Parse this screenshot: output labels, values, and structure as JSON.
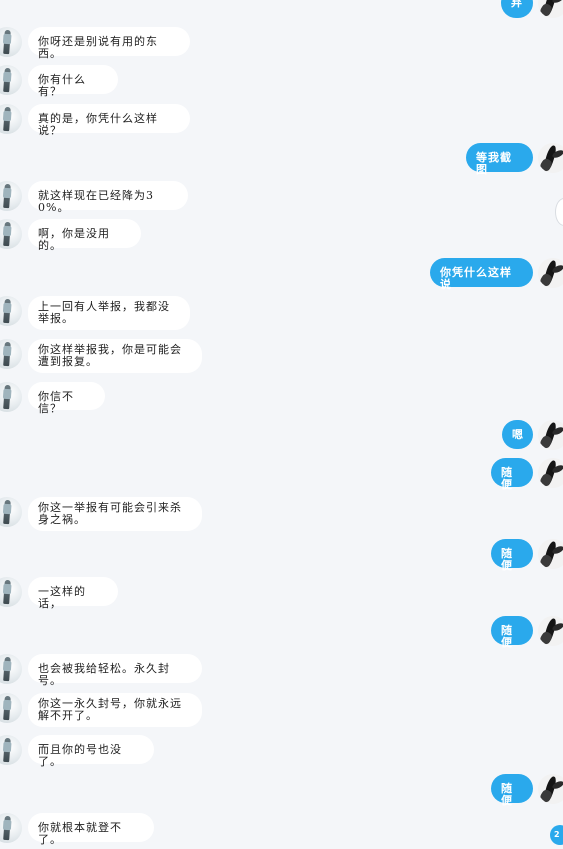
{
  "chat": {
    "messages": [
      {
        "side": "out",
        "text": "弃"
      },
      {
        "side": "in",
        "text": "你呀还是别说有用的东西。"
      },
      {
        "side": "in",
        "text": "你有什么有？"
      },
      {
        "side": "in",
        "text": "真的是，你凭什么这样说？"
      },
      {
        "side": "out",
        "text": "等我截图"
      },
      {
        "side": "in",
        "text": "就这样现在已经降为30%。"
      },
      {
        "side": "in",
        "text": "啊，你是没用的。"
      },
      {
        "side": "out",
        "text": "你凭什么这样说"
      },
      {
        "side": "in",
        "text": "上一回有人举报，我都没举报。"
      },
      {
        "side": "in",
        "text": "你这样举报我，你是可能会遭到报复。"
      },
      {
        "side": "in",
        "text": "你信不信？"
      },
      {
        "side": "out",
        "text": "嗯"
      },
      {
        "side": "out",
        "text": "随便"
      },
      {
        "side": "in",
        "text": "你这一举报有可能会引来杀身之祸。"
      },
      {
        "side": "out",
        "text": "随便"
      },
      {
        "side": "in",
        "text": "一这样的话，"
      },
      {
        "side": "out",
        "text": "随便"
      },
      {
        "side": "in",
        "text": "也会被我给轻松。永久封号。"
      },
      {
        "side": "in",
        "text": "你这一永久封号，你就永远解不开了。"
      },
      {
        "side": "in",
        "text": "而且你的号也没了。"
      },
      {
        "side": "out",
        "text": "随便"
      },
      {
        "side": "in",
        "text": "你就根本就登不了。"
      }
    ],
    "unread_badge": "2",
    "colors": {
      "background": "#f4f6f9",
      "incoming_bubble": "#ffffff",
      "outgoing_bubble": "#2aa9ec"
    }
  }
}
